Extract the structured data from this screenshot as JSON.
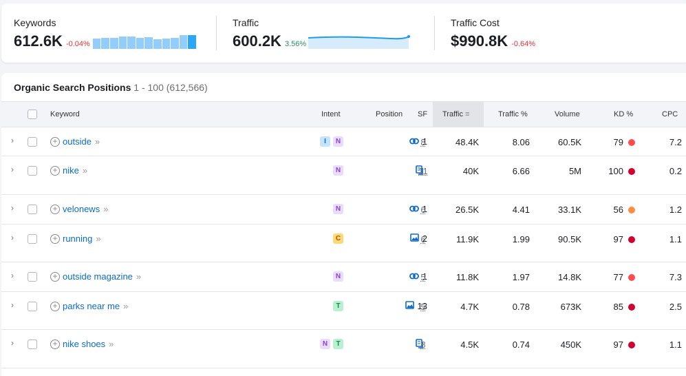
{
  "summary": {
    "keywords": {
      "label": "Keywords",
      "value": "612.6K",
      "delta": "-0.04%",
      "trend": [
        0.75,
        0.8,
        0.8,
        0.88,
        0.9,
        0.8,
        0.85,
        0.7,
        0.75,
        0.78,
        1,
        1
      ]
    },
    "traffic": {
      "label": "Traffic",
      "value": "600.2K",
      "delta": "3.56%"
    },
    "traffic_cost": {
      "label": "Traffic Cost",
      "value": "$990.8K",
      "delta": "-0.64%"
    }
  },
  "panel": {
    "title": "Organic Search Positions",
    "range": "1 - 100 (612,566)"
  },
  "columns": {
    "keyword": "Keyword",
    "intent": "Intent",
    "position": "Position",
    "sf": "SF",
    "traffic": "Traffic",
    "traffic_pct": "Traffic %",
    "volume": "Volume",
    "kd": "KD %",
    "cpc": "CPC"
  },
  "rows": [
    {
      "keyword": "outside",
      "intent": [
        "I",
        "N"
      ],
      "pos_icon": "link-icon",
      "position": "1",
      "sf": "8",
      "traffic": "48.4K",
      "traffic_pct": "8.06",
      "volume": "60.5K",
      "kd": "79",
      "kd_color": "#ff4d4d",
      "cpc": "7.2"
    },
    {
      "keyword": "nike",
      "intent": [
        "N"
      ],
      "pos_icon": "pages-icon",
      "position": "",
      "sf": "11",
      "traffic": "40K",
      "traffic_pct": "6.66",
      "volume": "5M",
      "kd": "100",
      "kd_color": "#d1002f",
      "cpc": "0.2"
    },
    {
      "keyword": "velonews",
      "intent": [
        "N"
      ],
      "pos_icon": "link-icon",
      "position": "1",
      "sf": "6",
      "traffic": "26.5K",
      "traffic_pct": "4.41",
      "volume": "33.1K",
      "kd": "56",
      "kd_color": "#ff8c42",
      "cpc": "1.2"
    },
    {
      "keyword": "running",
      "intent": [
        "C"
      ],
      "pos_icon": "image-icon",
      "position": "2",
      "sf": "6",
      "traffic": "11.9K",
      "traffic_pct": "1.99",
      "volume": "90.5K",
      "kd": "97",
      "kd_color": "#d1002f",
      "cpc": "1.1"
    },
    {
      "keyword": "outside magazine",
      "intent": [
        "N"
      ],
      "pos_icon": "link-icon",
      "position": "1",
      "sf": "5",
      "traffic": "11.8K",
      "traffic_pct": "1.97",
      "volume": "14.8K",
      "kd": "77",
      "kd_color": "#ff4d4d",
      "cpc": "7.3"
    },
    {
      "keyword": "parks near me",
      "intent": [
        "T"
      ],
      "pos_icon": "image-icon",
      "position": "13",
      "sf": "5",
      "traffic": "4.7K",
      "traffic_pct": "0.78",
      "volume": "673K",
      "kd": "85",
      "kd_color": "#d1002f",
      "cpc": "2.5"
    },
    {
      "keyword": "nike shoes",
      "intent": [
        "N",
        "T"
      ],
      "pos_icon": "pages-icon",
      "position": "",
      "sf": "8",
      "traffic": "4.5K",
      "traffic_pct": "0.74",
      "volume": "450K",
      "kd": "97",
      "kd_color": "#d1002f",
      "cpc": "1.1"
    }
  ]
}
